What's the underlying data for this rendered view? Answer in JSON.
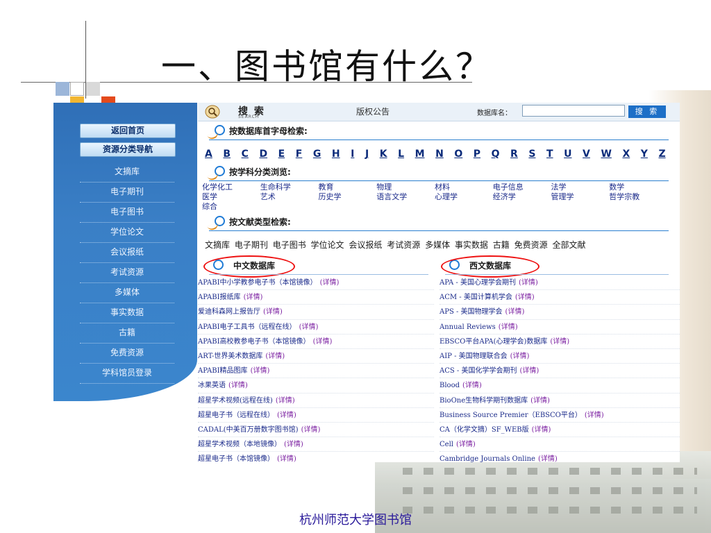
{
  "slide_title": "一、图书馆有什么？",
  "footer": "杭州师范大学图书馆",
  "colors": {
    "accent_blue": "#1f7bd6",
    "sidebar_blue": "#3a7fc6",
    "highlight_red": "#e11111",
    "link_purple": "#7a1ea0"
  },
  "sidebar": {
    "home_label": "返回首页",
    "nav_label": "资源分类导航",
    "items": [
      "文摘库",
      "电子期刊",
      "电子图书",
      "学位论文",
      "会议报纸",
      "考试资源",
      "多媒体",
      "事实数据",
      "古籍",
      "免费资源",
      "学科馆员登录"
    ]
  },
  "topbar": {
    "search_title": "搜 索",
    "search_sub": "SEARCH",
    "copyright": "版权公告",
    "db_name_label": "数据库名：",
    "db_input_value": "",
    "search_button": "搜 索",
    "search_icon": "magnifier-icon"
  },
  "sections": {
    "alpha": "按数据库首字母检索:",
    "subject": "按学科分类浏览:",
    "doctype": "按文献类型检索:"
  },
  "letters": [
    "A",
    "B",
    "C",
    "D",
    "E",
    "F",
    "G",
    "H",
    "I",
    "J",
    "K",
    "L",
    "M",
    "N",
    "O",
    "P",
    "Q",
    "R",
    "S",
    "T",
    "U",
    "V",
    "W",
    "X",
    "Y",
    "Z"
  ],
  "subjects": [
    [
      "化学化工",
      "生命科学",
      "教育",
      "物理",
      "材料",
      "电子信息",
      "法学",
      "数学"
    ],
    [
      "医学",
      "艺术",
      "历史学",
      "语言文学",
      "心理学",
      "经济学",
      "管理学",
      "哲学宗教"
    ],
    [
      "综合"
    ]
  ],
  "doctypes": [
    "文摘库",
    "电子期刊",
    "电子图书",
    "学位论文",
    "会议报纸",
    "考试资源",
    "多媒体",
    "事实数据",
    "古籍",
    "免费资源",
    "全部文献"
  ],
  "chinese_db": {
    "title": "中文数据库",
    "detail": "(详情)",
    "items": [
      "APABI中小学教参电子书（本馆镜像）",
      "APABI报纸库",
      "爱迪科森网上报告厅",
      "APABI电子工具书（远程在线）",
      "APABI高校教参电子书（本馆镜像）",
      "ART-世界美术数据库",
      "APABI精品图库",
      "冰果英语",
      "超星学术视频(远程在线)",
      "超星电子书（远程在线）",
      "CADAL(中美百万册数字图书馆)",
      "超星学术视频（本地镜像）",
      "超星电子书（本馆镜像）"
    ]
  },
  "western_db": {
    "title": "西文数据库",
    "detail": "(详情)",
    "items": [
      "APA - 美国心理学会期刊",
      "ACM - 美国计算机学会",
      "APS - 美国物理学会",
      "Annual Reviews",
      "EBSCO平台APA(心理学会)数据库",
      "AIP - 美国物理联合会",
      "ACS - 美国化学学会期刊",
      "Blood",
      "BioOne生物科学期刊数据库",
      "Business Source Premier（EBSCO平台）",
      "CA（化学文摘）SF_WEB版",
      "Cell",
      "Cambridge Journals Online"
    ]
  }
}
